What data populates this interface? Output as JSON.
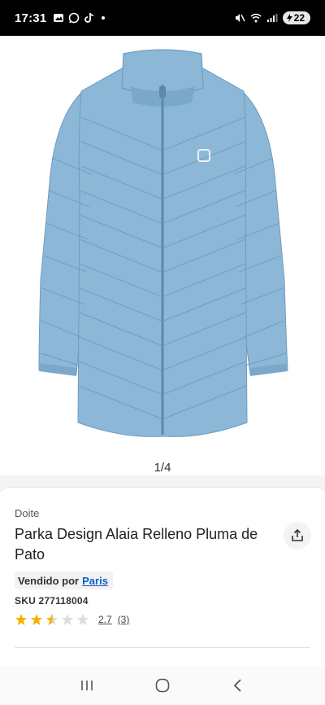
{
  "status_bar": {
    "time": "17:31",
    "battery": "22",
    "icons": [
      "gallery-icon",
      "whatsapp-icon",
      "tiktok-icon",
      "dot-icon",
      "mute-icon",
      "wifi-icon",
      "signal-icon",
      "battery-icon"
    ]
  },
  "gallery": {
    "image_alt": "Light blue long quilted down parka",
    "counter": "1/4",
    "colors": {
      "jacket": "#8db7d6",
      "jacket_shadow": "#6f9cbe",
      "jacket_highlight": "#a9cae2"
    }
  },
  "product": {
    "brand": "Doite",
    "title": "Parka Design Alaia Relleno Pluma de Pato",
    "seller_prefix": "Vendido por",
    "seller_name": "Paris",
    "sku": "SKU 277118004",
    "rating_value": "2.7",
    "rating_count": "(3)",
    "rating_fraction": 0.54,
    "stars": 5
  },
  "nav": {
    "buttons": [
      "recent-apps-button",
      "home-button",
      "back-button"
    ]
  },
  "colors": {
    "star_filled": "#f4b400",
    "star_empty": "#dcdcdc",
    "link": "#1160c9"
  }
}
